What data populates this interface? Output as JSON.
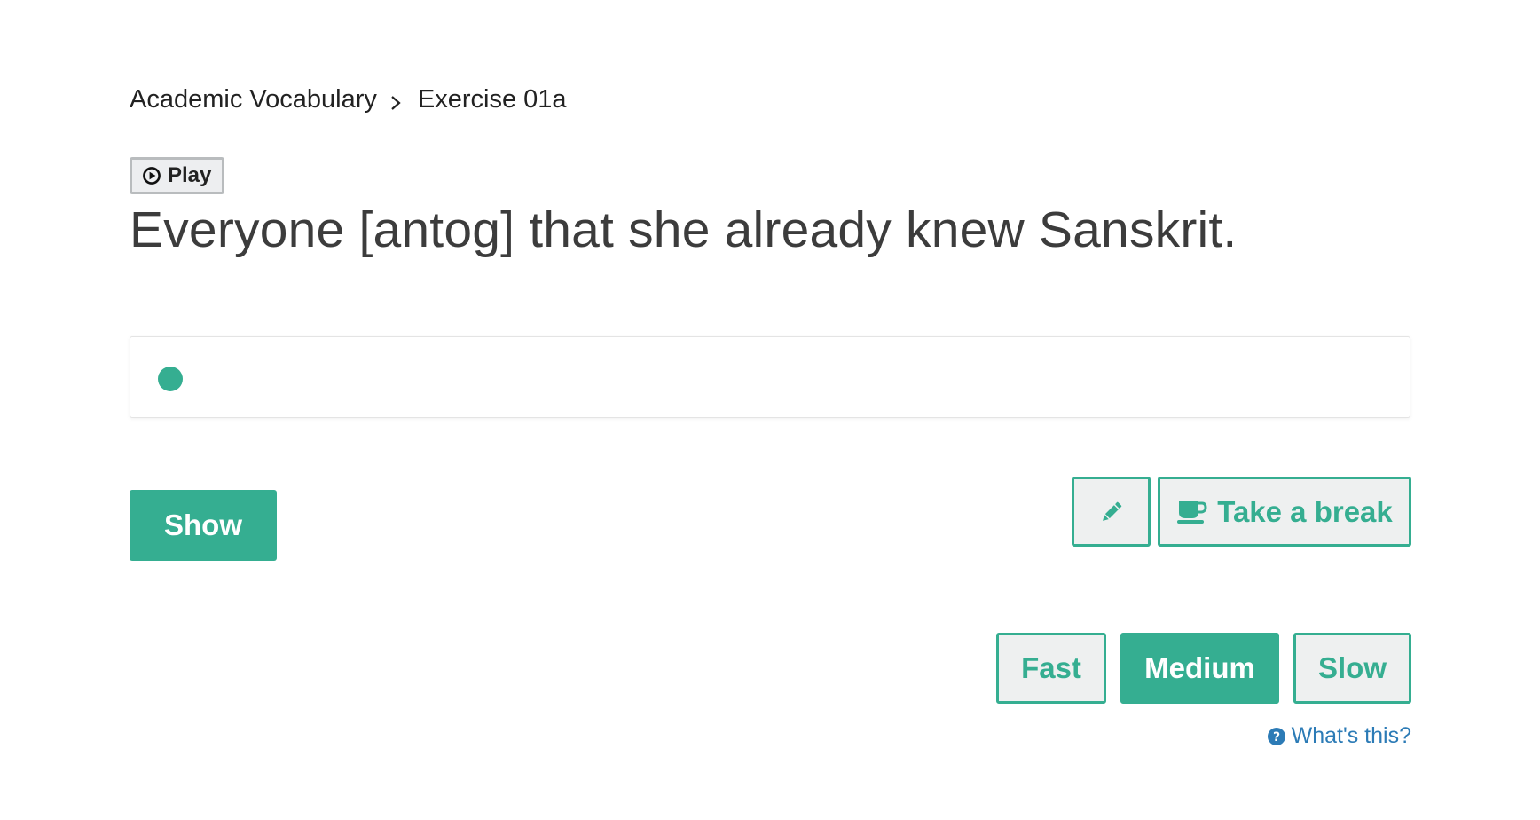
{
  "breadcrumb": {
    "course": "Academic Vocabulary",
    "separator_icon": "chevron-right-icon",
    "exercise": "Exercise 01a"
  },
  "play": {
    "icon": "play-circle-icon",
    "label": "Play"
  },
  "sentence": "Everyone [antog] that she already knew Sanskrit.",
  "answer": {
    "indicator_icon": "status-dot",
    "value": ""
  },
  "actions": {
    "show_label": "Show",
    "edit_icon": "pencil-icon",
    "break_icon": "coffee-cup-icon",
    "break_label": "Take a break"
  },
  "speed": {
    "options": [
      "Fast",
      "Medium",
      "Slow"
    ],
    "selected": "Medium"
  },
  "help": {
    "icon": "question-circle-icon",
    "label": "What's this?"
  },
  "colors": {
    "accent": "#35ae91",
    "link": "#2c7bb6",
    "button_bg": "#eef0f0",
    "text": "#3c3c3c"
  }
}
